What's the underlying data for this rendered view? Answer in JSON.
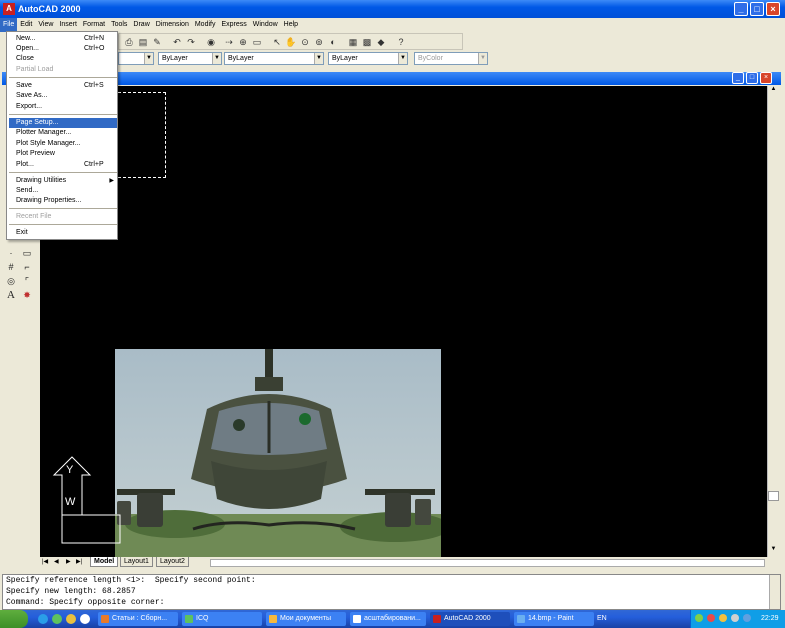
{
  "window": {
    "title": "AutoCAD 2000",
    "min": "_",
    "max": "□",
    "close": "×"
  },
  "menubar": [
    "File",
    "Edit",
    "View",
    "Insert",
    "Format",
    "Tools",
    "Draw",
    "Dimension",
    "Modify",
    "Express",
    "Window",
    "Help"
  ],
  "toolbar": {
    "layer_combo": "ByLayer",
    "linetype_combo": "ByLayer",
    "lineweight_combo": "ByLayer",
    "plotstyle_combo": "ByColor"
  },
  "file_menu": {
    "items": [
      {
        "label": "New...",
        "shortcut": "Ctrl+N",
        "disabled": false
      },
      {
        "label": "Open...",
        "shortcut": "Ctrl+O",
        "disabled": false
      },
      {
        "label": "Close",
        "shortcut": "",
        "disabled": false
      },
      {
        "label": "Partial Load",
        "shortcut": "",
        "disabled": true
      },
      {
        "label": "Save",
        "shortcut": "Ctrl+S",
        "disabled": false
      },
      {
        "label": "Save As...",
        "shortcut": "",
        "disabled": false
      },
      {
        "label": "Export...",
        "shortcut": "",
        "disabled": false
      },
      {
        "label": "Page Setup...",
        "shortcut": "",
        "disabled": false,
        "highlighted": true
      },
      {
        "label": "Plotter Manager...",
        "shortcut": "",
        "disabled": false
      },
      {
        "label": "Plot Style Manager...",
        "shortcut": "",
        "disabled": false
      },
      {
        "label": "Plot Preview",
        "shortcut": "",
        "disabled": false
      },
      {
        "label": "Plot...",
        "shortcut": "Ctrl+P",
        "disabled": false
      },
      {
        "label": "Drawing Utilities",
        "shortcut": "",
        "disabled": false,
        "submenu": true
      },
      {
        "label": "Send...",
        "shortcut": "",
        "disabled": false
      },
      {
        "label": "Drawing Properties...",
        "shortcut": "",
        "disabled": false
      },
      {
        "label": "Recent File",
        "shortcut": "",
        "disabled": true
      },
      {
        "label": "Exit",
        "shortcut": "",
        "disabled": false
      }
    ]
  },
  "layout_tabs": [
    "Model",
    "Layout1",
    "Layout2"
  ],
  "ucs": {
    "y": "Y",
    "w": "W"
  },
  "command_lines": [
    "Specify reference length <1>:  Specify second point:",
    "Specify new length: 68.2857",
    "Command: Specify opposite corner:"
  ],
  "taskbar": {
    "tasks": [
      {
        "label": "Статьи : Сборн...",
        "active": false
      },
      {
        "label": "ICQ",
        "active": false
      },
      {
        "label": "Мои документы",
        "active": false
      },
      {
        "label": "асштабировани...",
        "active": false
      },
      {
        "label": "AutoCAD 2000",
        "active": true
      },
      {
        "label": "14.bmp - Paint",
        "active": false
      }
    ],
    "lang": "EN",
    "clock": "22:29"
  },
  "colors": {
    "accent": "#316ac5",
    "canvas": "#000000",
    "titlebar": "#0058e6"
  }
}
